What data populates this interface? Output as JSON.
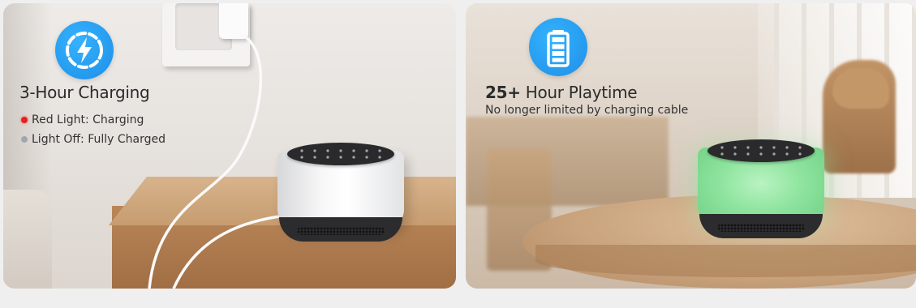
{
  "left_panel": {
    "icon": "lightning-charge-icon",
    "title": "3-Hour Charging",
    "indicators": [
      {
        "label": "Red Light: Charging",
        "color": "#e3221f"
      },
      {
        "label": "Light Off: Fully Charged",
        "color": "#9fa7b0"
      }
    ]
  },
  "right_panel": {
    "icon": "battery-full-icon",
    "title_bold": "25+",
    "title_rest": " Hour Playtime",
    "subtitle": "No longer limited by charging cable"
  },
  "colors": {
    "icon_blue": "#1e8fe6",
    "night_light_green": "#8fe49f",
    "device_white": "#f7f7f8",
    "device_dark": "#2c2c2e"
  }
}
